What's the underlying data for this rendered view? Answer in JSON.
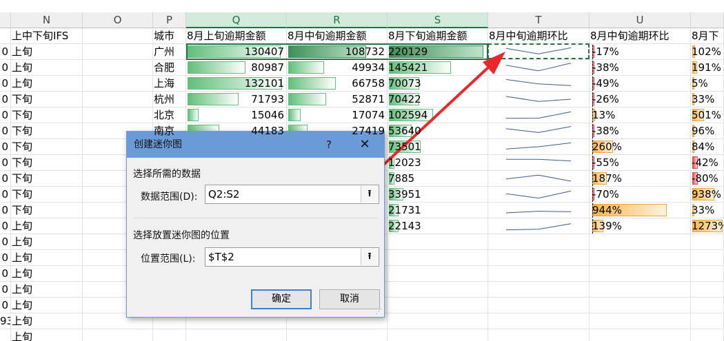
{
  "columns": [
    "N",
    "O",
    "P",
    "Q",
    "R",
    "S",
    "T",
    "U"
  ],
  "header_row": {
    "N": "上中下旬IFS",
    "P": "城市",
    "Q": "8月上旬逾期金额",
    "R": "8月中旬逾期金额",
    "S": "8月下旬逾期金额",
    "T": "8月中旬逾期环比",
    "U": "8月中旬逾期环比",
    "V": "8月下"
  },
  "rows": [
    {
      "m": "0",
      "n": "上旬",
      "p": "广州",
      "q": "130407",
      "r": "108732",
      "s": "220129",
      "u": "-17%",
      "v": "102%"
    },
    {
      "m": "0",
      "n": "上旬",
      "p": "合肥",
      "q": "80987",
      "r": "49934",
      "s": "145421",
      "u": "-38%",
      "v": "191%"
    },
    {
      "m": "0",
      "n": "上旬",
      "p": "上海",
      "q": "132101",
      "r": "66758",
      "s": "70073",
      "u": "-49%",
      "v": "5%"
    },
    {
      "m": "0",
      "n": "下旬",
      "p": "杭州",
      "q": "71793",
      "r": "52871",
      "s": "70422",
      "u": "-26%",
      "v": "33%"
    },
    {
      "m": "0",
      "n": "下旬",
      "p": "北京",
      "q": "15046",
      "r": "17074",
      "s": "102594",
      "u": "13%",
      "v": "501%"
    },
    {
      "m": "0",
      "n": "下旬",
      "p": "南京",
      "q": "44183",
      "r": "27419",
      "s": "53640",
      "u": "-38%",
      "v": "96%"
    },
    {
      "m": "0",
      "n": "下旬",
      "p": "",
      "q": "",
      "r": "",
      "s": "73501",
      "u": "260%",
      "v": "84%"
    },
    {
      "m": "0",
      "n": "下旬",
      "p": "",
      "q": "",
      "r": "",
      "s": "12023",
      "u": "-55%",
      "v": "-42%"
    },
    {
      "m": "0",
      "n": "下旬",
      "p": "",
      "q": "",
      "r": "",
      "s": "7885",
      "u": "187%",
      "v": "-80%"
    },
    {
      "m": "0",
      "n": "下旬",
      "p": "",
      "q": "",
      "r": "",
      "s": "33951",
      "u": "-70%",
      "v": "938%"
    },
    {
      "m": "0",
      "n": "下旬",
      "p": "",
      "q": "",
      "r": "",
      "s": "21731",
      "u": "944%",
      "v": "33%"
    },
    {
      "m": "0",
      "n": "上旬",
      "p": "",
      "q": "",
      "r": "",
      "s": "22143",
      "u": "139%",
      "v": "1273%"
    },
    {
      "m": "0",
      "n": "上旬",
      "p": "",
      "q": "",
      "r": "",
      "s": "",
      "u": "",
      "v": ""
    },
    {
      "m": "0",
      "n": "上旬",
      "p": "",
      "q": "",
      "r": "",
      "s": "",
      "u": "",
      "v": ""
    },
    {
      "m": "0",
      "n": "上旬",
      "p": "",
      "q": "",
      "r": "",
      "s": "",
      "u": "",
      "v": ""
    },
    {
      "m": "0",
      "n": "上旬",
      "p": "",
      "q": "",
      "r": "",
      "s": "",
      "u": "",
      "v": ""
    },
    {
      "m": "0",
      "n": "上旬",
      "p": "",
      "q": "",
      "r": "",
      "s": "",
      "u": "",
      "v": ""
    },
    {
      "m": "93",
      "n": "上旬",
      "p": "",
      "q": "",
      "r": "",
      "s": "",
      "u": "",
      "v": ""
    },
    {
      "m": "",
      "n": "上旬",
      "p": "",
      "q": "",
      "r": "",
      "s": "",
      "u": "",
      "v": ""
    }
  ],
  "dialog": {
    "title": "创建迷你图",
    "help": "?",
    "close": "✕",
    "section_data": "选择所需的数据",
    "data_range_label": "数据范围(D):",
    "data_range_value": "Q2:S2",
    "section_location": "选择放置迷你图的位置",
    "location_range_label": "位置范围(L):",
    "location_range_value": "$T$2",
    "ok": "确定",
    "cancel": "取消"
  },
  "colors": {
    "accent": "#217346",
    "databar_green": "#63be7b",
    "databar_orange": "#f8b54a",
    "databar_red": "#e84b4b",
    "dialog_title": "#6a9bd8",
    "arrow": "#e8282a"
  }
}
